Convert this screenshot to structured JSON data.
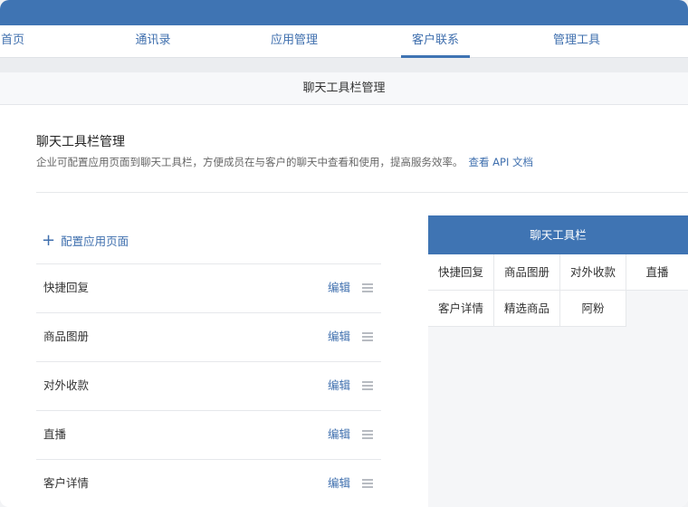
{
  "nav": {
    "items": [
      {
        "label": "首页",
        "active": false
      },
      {
        "label": "通讯录",
        "active": false
      },
      {
        "label": "应用管理",
        "active": false
      },
      {
        "label": "客户联系",
        "active": true
      },
      {
        "label": "管理工具",
        "active": false
      }
    ]
  },
  "header": {
    "title": "聊天工具栏管理"
  },
  "main": {
    "title": "聊天工具栏管理",
    "description": "企业可配置应用页面到聊天工具栏，方便成员在与客户的聊天中查看和使用，提高服务效率。",
    "api_link": "查看 API 文档",
    "add_label": "配置应用页面",
    "edit_label": "编辑",
    "items": [
      "快捷回复",
      "商品图册",
      "对外收款",
      "直播",
      "客户详情"
    ]
  },
  "preview": {
    "title": "聊天工具栏",
    "cells": [
      "快捷回复",
      "商品图册",
      "对外收款",
      "直播",
      "客户详情",
      "精选商品",
      "阿粉"
    ]
  },
  "colors": {
    "accent": "#3f74b3",
    "link": "#3f6fae"
  }
}
